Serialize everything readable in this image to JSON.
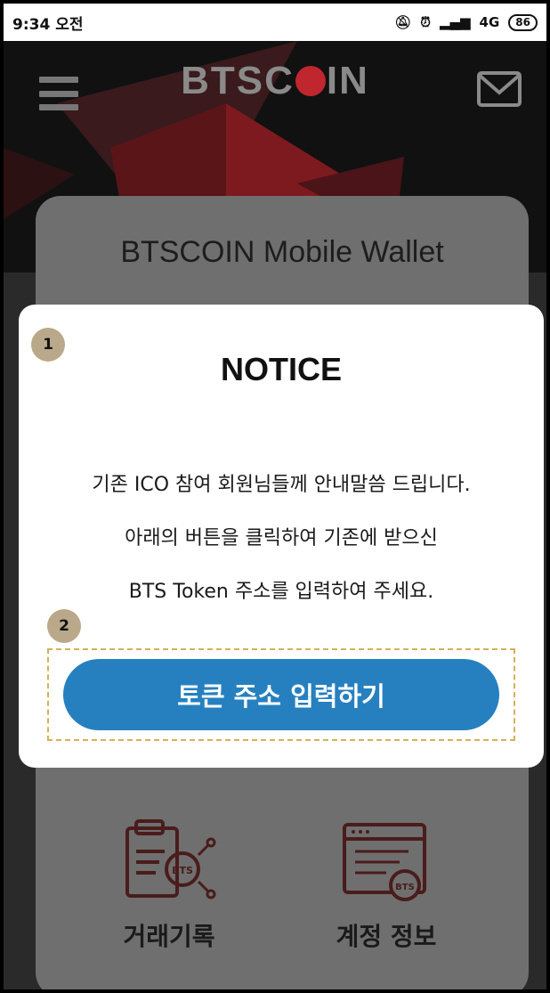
{
  "status_bar": {
    "time": "9:34 오전",
    "network": "4G",
    "battery": "86"
  },
  "header": {
    "logo_text_left": "BTSC",
    "logo_text_right": "IN",
    "icons": [
      "hamburger-menu-icon",
      "mail-icon"
    ]
  },
  "wallet": {
    "title": "BTSCOIN Mobile Wallet",
    "menu": [
      {
        "label": "거래기록",
        "icon": "transaction-history-icon"
      },
      {
        "label": "계정 정보",
        "icon": "account-info-icon"
      }
    ]
  },
  "modal": {
    "badge1": "1",
    "badge2": "2",
    "title": "NOTICE",
    "lines": [
      "기존 ICO 참여 회원님들께 안내말씀 드립니다.",
      "아래의 버튼을 클릭하여 기존에 받으신",
      "BTS Token 주소를 입력하여 주세요."
    ],
    "button_label": "토큰 주소 입력하기"
  },
  "colors": {
    "accent_red": "#c0262d",
    "button_blue": "#2680c0",
    "badge": "#b9a98a",
    "dashed_highlight": "#d4b15a"
  }
}
